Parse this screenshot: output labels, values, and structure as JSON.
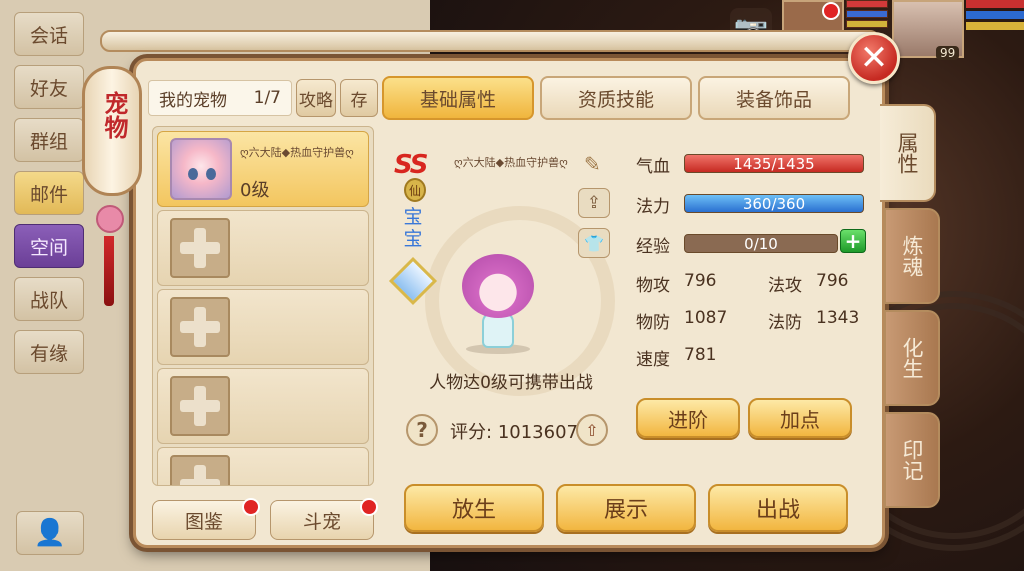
{
  "side_tabs": [
    "会话",
    "好友",
    "群组",
    "邮件",
    "空间",
    "战队",
    "有缘"
  ],
  "lantern_text": "宠物",
  "hud": {
    "level": "99"
  },
  "pet_panel": {
    "title": "我的宠物",
    "count": "1/7",
    "guide_label": "攻略",
    "store_label": "存"
  },
  "main_tabs": [
    "基础属性",
    "资质技能",
    "装备饰品"
  ],
  "right_tabs": [
    "属性",
    "炼魂",
    "化生",
    "印记"
  ],
  "pet_list": [
    {
      "name": "ღ六大陆◆热血守护兽ღ",
      "level": "0级",
      "selected": true
    },
    {
      "empty": true
    },
    {
      "empty": true
    },
    {
      "empty": true
    },
    {
      "empty": true
    }
  ],
  "bottom_left_buttons": {
    "codex": "图鉴",
    "battle_pet": "斗宠"
  },
  "pet_detail": {
    "rank": "SS",
    "immortal_badge": "仙",
    "type": "宝宝",
    "name": "ღ六大陆◆热血守护兽ღ",
    "carry_hint": "人物达0级可携带出战",
    "score_label": "评分:",
    "score_value": "1013607"
  },
  "stats": {
    "hp_label": "气血",
    "hp_text": "1435/1435",
    "hp_fraction": 1.0,
    "mp_label": "法力",
    "mp_text": "360/360",
    "mp_fraction": 1.0,
    "exp_label": "经验",
    "exp_text": "0/10",
    "exp_fraction": 0.0,
    "phys_atk_label": "物攻",
    "phys_atk": "796",
    "mag_atk_label": "法攻",
    "mag_atk": "796",
    "phys_def_label": "物防",
    "phys_def": "1087",
    "mag_def_label": "法防",
    "mag_def": "1343",
    "speed_label": "速度",
    "speed": "781"
  },
  "stat_buttons": {
    "advance": "进阶",
    "add_points": "加点"
  },
  "action_buttons": {
    "release": "放生",
    "show": "展示",
    "fight": "出战"
  },
  "colors": {
    "accent_gold": "#f2b640",
    "hp_red": "#c62a22",
    "mp_blue": "#2a70d0",
    "close_red": "#c62a22"
  }
}
